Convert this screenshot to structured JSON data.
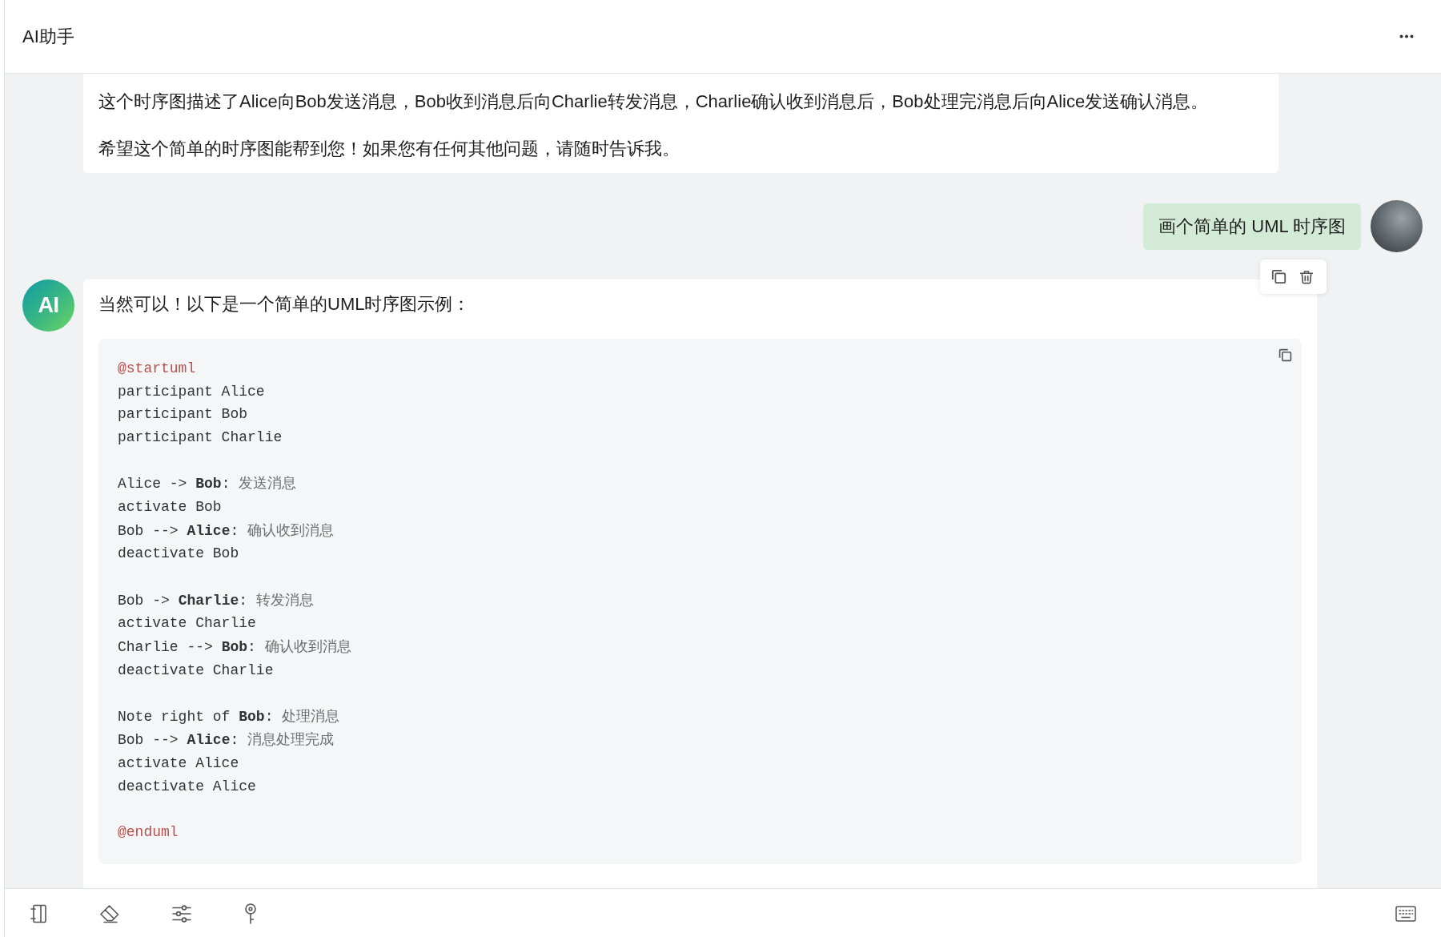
{
  "header": {
    "title": "AI助手"
  },
  "messages": [
    {
      "kind": "assistant",
      "blocks": [
        {
          "kind": "text",
          "text": "这个时序图描述了Alice向Bob发送消息，Bob收到消息后向Charlie转发消息，Charlie确认收到消息后，Bob处理完消息后向Alice发送确认消息。"
        },
        {
          "kind": "text",
          "text": "希望这个简单的时序图能帮到您！如果您有任何其他问题，请随时告诉我。"
        }
      ]
    },
    {
      "kind": "user",
      "text": "画个简单的 UML 时序图",
      "actions_shown": true
    },
    {
      "kind": "assistant",
      "avatar_text": "AI",
      "blocks": [
        {
          "kind": "text",
          "text": "当然可以！以下是一个简单的UML时序图示例："
        },
        {
          "kind": "code",
          "groups": [
            [
              [
                {
                  "kind": "directive",
                  "text": "@startuml"
                }
              ],
              [
                {
                  "kind": "plain",
                  "text": "participant Alice"
                }
              ],
              [
                {
                  "kind": "plain",
                  "text": "participant Bob"
                }
              ],
              [
                {
                  "kind": "plain",
                  "text": "participant Charlie"
                }
              ]
            ],
            [
              [
                {
                  "kind": "plain",
                  "text": "Alice -> "
                },
                {
                  "kind": "name",
                  "text": "Bob"
                },
                {
                  "kind": "plain",
                  "text": ": "
                },
                {
                  "kind": "label",
                  "text": "发送消息"
                }
              ],
              [
                {
                  "kind": "plain",
                  "text": "activate Bob"
                }
              ],
              [
                {
                  "kind": "plain",
                  "text": "Bob --> "
                },
                {
                  "kind": "name",
                  "text": "Alice"
                },
                {
                  "kind": "plain",
                  "text": ": "
                },
                {
                  "kind": "label",
                  "text": "确认收到消息"
                }
              ],
              [
                {
                  "kind": "plain",
                  "text": "deactivate Bob"
                }
              ]
            ],
            [
              [
                {
                  "kind": "plain",
                  "text": "Bob -> "
                },
                {
                  "kind": "name",
                  "text": "Charlie"
                },
                {
                  "kind": "plain",
                  "text": ": "
                },
                {
                  "kind": "label",
                  "text": "转发消息"
                }
              ],
              [
                {
                  "kind": "plain",
                  "text": "activate Charlie"
                }
              ],
              [
                {
                  "kind": "plain",
                  "text": "Charlie --> "
                },
                {
                  "kind": "name",
                  "text": "Bob"
                },
                {
                  "kind": "plain",
                  "text": ": "
                },
                {
                  "kind": "label",
                  "text": "确认收到消息"
                }
              ],
              [
                {
                  "kind": "plain",
                  "text": "deactivate Charlie"
                }
              ]
            ],
            [
              [
                {
                  "kind": "plain",
                  "text": "Note right of "
                },
                {
                  "kind": "name",
                  "text": "Bob"
                },
                {
                  "kind": "plain",
                  "text": ": "
                },
                {
                  "kind": "label",
                  "text": "处理消息"
                }
              ],
              [
                {
                  "kind": "plain",
                  "text": "Bob --> "
                },
                {
                  "kind": "name",
                  "text": "Alice"
                },
                {
                  "kind": "plain",
                  "text": ": "
                },
                {
                  "kind": "label",
                  "text": "消息处理完成"
                }
              ],
              [
                {
                  "kind": "plain",
                  "text": "activate Alice"
                }
              ],
              [
                {
                  "kind": "plain",
                  "text": "deactivate Alice"
                }
              ]
            ],
            [
              [
                {
                  "kind": "directive",
                  "text": "@enduml"
                }
              ]
            ]
          ]
        }
      ]
    }
  ]
}
